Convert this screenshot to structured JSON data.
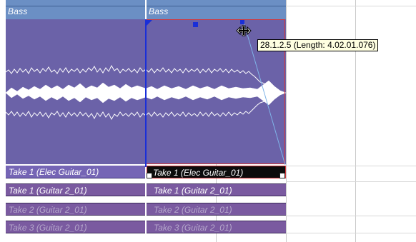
{
  "track_headers": [
    {
      "label": "Bass"
    },
    {
      "label": "Bass"
    }
  ],
  "event_labels": {
    "left": "Take 1 (Elec Guitar_01)",
    "right_selected": "Take 1 (Elec Guitar_01)"
  },
  "lanes": [
    {
      "left": "Take 1 (Guitar 2_01)",
      "right": "Take 1 (Guitar 2_01)",
      "muted": false
    },
    {
      "left": "Take 2 (Guitar 2_01)",
      "right": "Take 2 (Guitar 2_01)",
      "muted": true
    },
    {
      "left": "Take 3 (Guitar 2_01)",
      "right": "Take 3 (Guitar 2_01)",
      "muted": true
    }
  ],
  "tooltip": {
    "text": "28.1.2.5 (Length: 4.02.01.076)"
  },
  "icons": {
    "cursor": "horizontal-resize-cursor-icon",
    "fade_handle": "fade-handle-icon",
    "volume_handle": "volume-handle-icon"
  },
  "colors": {
    "waveform_bg": "#6b62a8",
    "header_bg": "#6b8fc4",
    "selection_border": "#d4363a",
    "cursor_line": "#1a2fd8",
    "fade_line": "#7fb4e8"
  }
}
